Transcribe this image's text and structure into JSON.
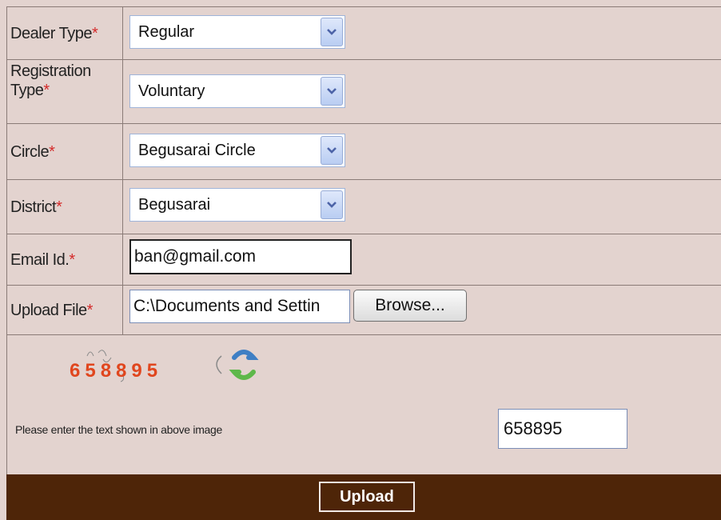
{
  "form": {
    "dealer_type": {
      "label": "Dealer Type",
      "required": "*",
      "value": "Regular"
    },
    "registration_type": {
      "label_line1": "Registration",
      "label_line2": "Type",
      "required": "*",
      "value": "Voluntary"
    },
    "circle": {
      "label": "Circle",
      "required": "*",
      "value": "Begusarai Circle"
    },
    "district": {
      "label": "District",
      "required": "*",
      "value": "Begusarai"
    },
    "email": {
      "label": "Email Id.",
      "required": "*",
      "value": "ban@gmail.com"
    },
    "upload_file": {
      "label": "Upload File",
      "required": "*",
      "value": "C:\\Documents and Settin",
      "browse_label": "Browse..."
    }
  },
  "captcha": {
    "image_text": "658895",
    "prompt": "Please enter the text shown in above image",
    "input_value": "658895"
  },
  "footer": {
    "upload_label": "Upload"
  },
  "colors": {
    "background": "#e3d3cf",
    "footer": "#4e2508",
    "required": "#d42a2a",
    "captcha_digits": "#e0461e"
  },
  "icons": {
    "dropdown": "chevron-down-icon",
    "refresh": "refresh-captcha-icon"
  }
}
